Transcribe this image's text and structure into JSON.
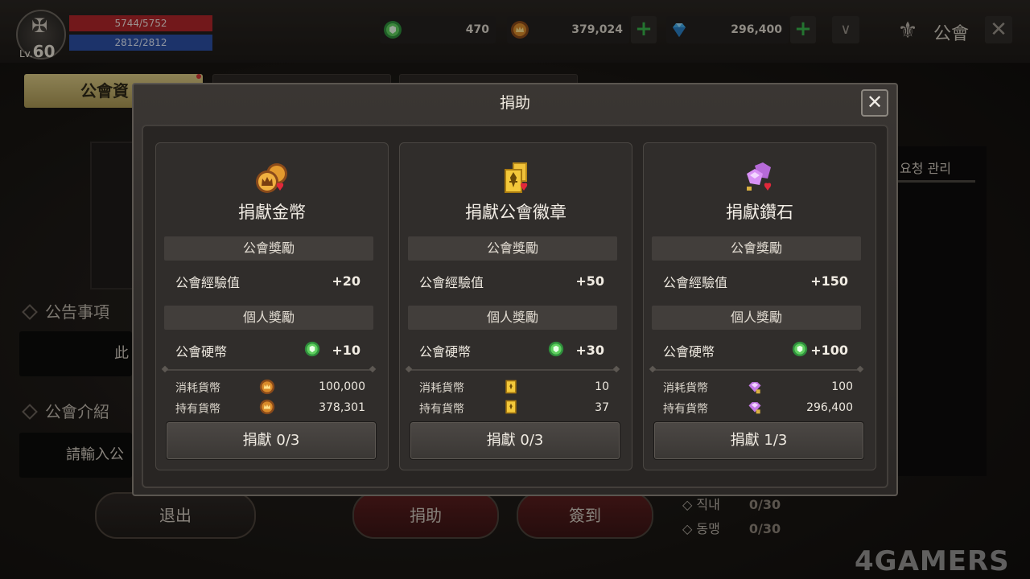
{
  "player": {
    "level_prefix": "Lv.",
    "level": "60",
    "hp": "5744/5752",
    "mp": "2812/2812"
  },
  "currencies": [
    {
      "icon": "guild-coin-icon",
      "value": "470"
    },
    {
      "icon": "gold-coin-icon",
      "value": "379,024"
    },
    {
      "icon": "diamond-icon",
      "value": "296,400"
    }
  ],
  "header": {
    "guild_label": "公會"
  },
  "background": {
    "tab_active": "公會資",
    "notice_label": "公告事項",
    "notice_text": "此",
    "intro_label": "公會介紹",
    "intro_placeholder": "請輸入公",
    "exit_button": "退出",
    "donate_button": "捐助",
    "checkin_button": "簽到",
    "right_panel_text": "요청 관리",
    "stat1_label": "직내",
    "stat1_value": "0/30",
    "stat2_label": "동맹",
    "stat2_value": "0/30"
  },
  "modal": {
    "title": "捐助",
    "cards": [
      {
        "title": "捐獻金幣",
        "guild_reward_header": "公會獎勵",
        "guild_exp_label": "公會經驗值",
        "guild_exp_value": "+20",
        "personal_reward_header": "個人獎勵",
        "guild_coin_label": "公會硬幣",
        "guild_coin_value": "+10",
        "cost_label": "消耗貨幣",
        "cost_value": "100,000",
        "owned_label": "持有貨幣",
        "owned_value": "378,301",
        "currency_icon": "gold-coin-icon",
        "button": "捐獻 0/3"
      },
      {
        "title": "捐獻公會徽章",
        "guild_reward_header": "公會獎勵",
        "guild_exp_label": "公會經驗值",
        "guild_exp_value": "+50",
        "personal_reward_header": "個人獎勵",
        "guild_coin_label": "公會硬幣",
        "guild_coin_value": "+30",
        "cost_label": "消耗貨幣",
        "cost_value": "10",
        "owned_label": "持有貨幣",
        "owned_value": "37",
        "currency_icon": "guild-badge-icon",
        "button": "捐獻 0/3"
      },
      {
        "title": "捐獻鑽石",
        "guild_reward_header": "公會獎勵",
        "guild_exp_label": "公會經驗值",
        "guild_exp_value": "+150",
        "personal_reward_header": "個人獎勵",
        "guild_coin_label": "公會硬幣",
        "guild_coin_value": "+100",
        "cost_label": "消耗貨幣",
        "cost_value": "100",
        "owned_label": "持有貨幣",
        "owned_value": "296,400",
        "currency_icon": "purple-gem-icon",
        "button": "捐獻 1/3"
      }
    ]
  },
  "watermark": "4GAMERS",
  "colors": {
    "hp": "#b0262a",
    "mp": "#2c4fa3",
    "plus": "#38b24a",
    "tab_gold": "#d9c884"
  }
}
